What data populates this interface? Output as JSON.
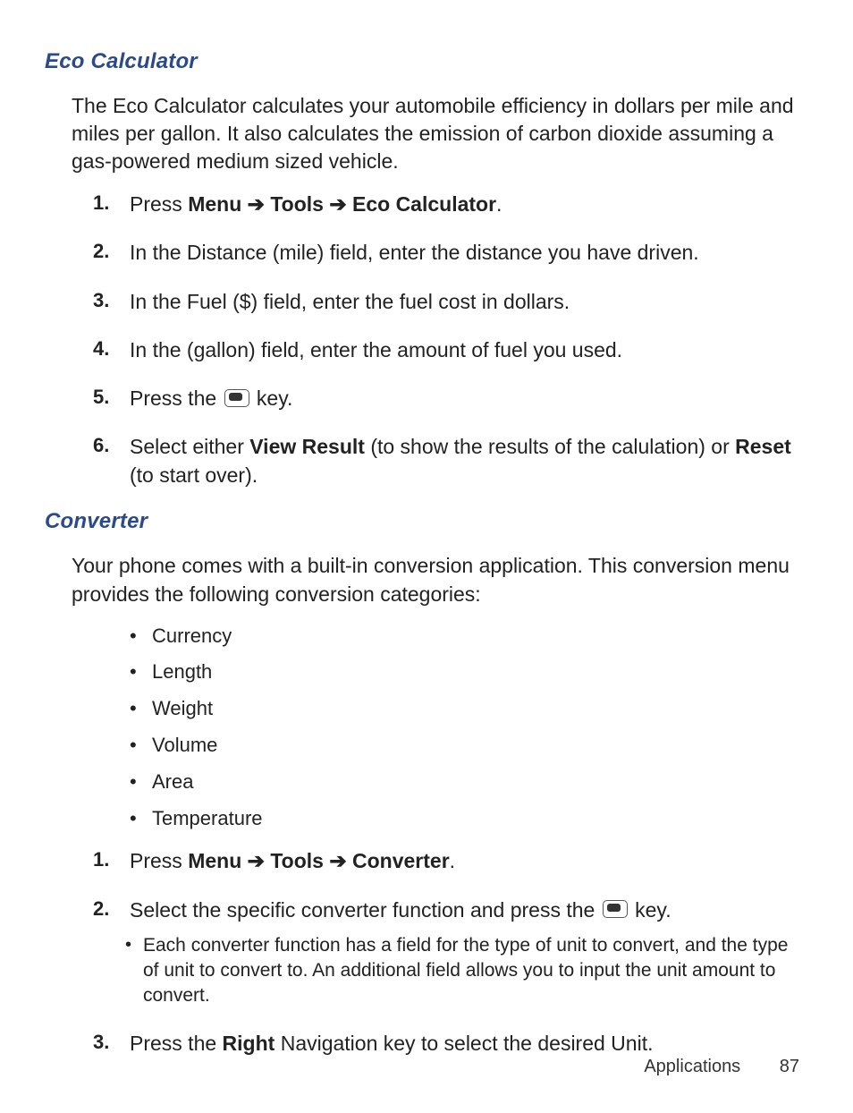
{
  "sections": {
    "eco": {
      "heading": "Eco Calculator",
      "intro": "The Eco Calculator calculates your automobile efficiency in dollars per mile and miles per gallon. It also calculates the emission of carbon dioxide assuming a gas-powered medium sized vehicle.",
      "steps": {
        "s1_prefix": "Press ",
        "s1_menu": "Menu",
        "s1_tools": "Tools",
        "s1_eco": "Eco Calculator",
        "arrow": " ➔ ",
        "period": ".",
        "s2": "In the Distance (mile) field, enter the distance you have driven.",
        "s3": "In the Fuel ($) field, enter the fuel cost in dollars.",
        "s4": "In the (gallon) field, enter the amount of fuel you used.",
        "s5_prefix": "Press the ",
        "s5_suffix": " key.",
        "s6_prefix": "Select either ",
        "s6_vr": "View Result",
        "s6_mid": " (to show the results of the calulation) or ",
        "s6_reset": "Reset",
        "s6_suffix": " (to start over)."
      }
    },
    "converter": {
      "heading": "Converter",
      "intro": "Your phone comes with a built-in conversion application. This conversion menu provides the following conversion categories:",
      "bullets": {
        "b1": "Currency",
        "b2": "Length",
        "b3": "Weight",
        "b4": "Volume",
        "b5": "Area",
        "b6": "Temperature"
      },
      "steps": {
        "s1_prefix": "Press ",
        "s1_menu": "Menu",
        "s1_tools": "Tools",
        "s1_conv": "Converter",
        "arrow": " ➔ ",
        "period": ".",
        "s2_prefix": "Select the specific converter function and press the ",
        "s2_suffix": " key.",
        "s2_sub": "Each converter function has a field for the type of unit to convert, and the type of unit to convert to. An additional field allows you to input the unit amount to convert.",
        "s3_prefix": "Press the ",
        "s3_right": "Right",
        "s3_suffix": " Navigation key to select the desired Unit."
      }
    }
  },
  "footer": {
    "section": "Applications",
    "page": "87"
  },
  "icons": {
    "ok_key": "ok-key"
  }
}
